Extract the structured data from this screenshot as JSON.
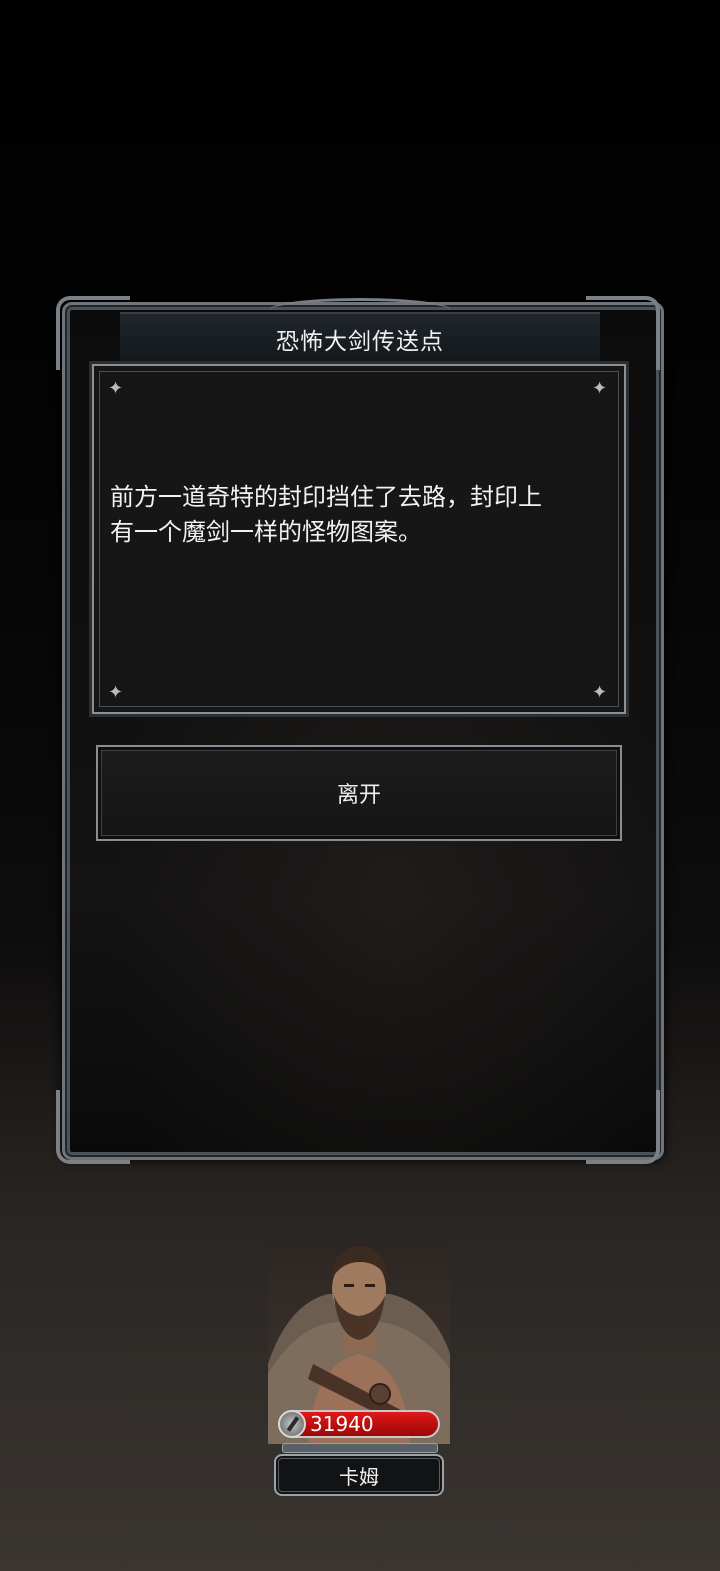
{
  "dialog": {
    "title": "恐怖大剑传送点",
    "story_line1": "前方一道奇特的封印挡住了去路，封印上",
    "story_line2": "有一个魔剑一样的怪物图案。",
    "leave_label": "离开"
  },
  "hero": {
    "hp": "31940",
    "name": "卡姆"
  },
  "colors": {
    "hp_bar": "#d01212",
    "frame": "#7b8186"
  }
}
